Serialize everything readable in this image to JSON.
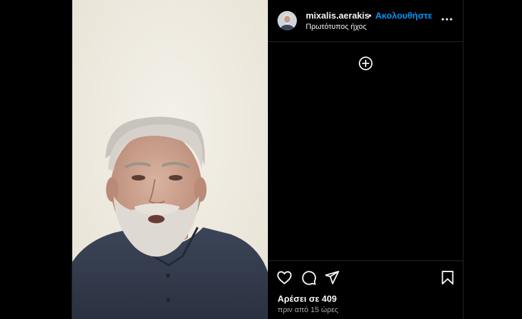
{
  "post": {
    "username": "mixalis.aerakis",
    "separator": "•",
    "follow_label": "Ακολουθήστε",
    "audio_label": "Πρωτότυπος ήχος",
    "likes_text": "Αρέσει σε 409",
    "timestamp": "πριν από 15 ώρες"
  },
  "icons": {
    "more": "more-options-icon",
    "add_comment": "add-circle-icon",
    "like": "heart-icon",
    "comment": "comment-icon",
    "share": "send-icon",
    "save": "bookmark-icon"
  },
  "colors": {
    "background": "#000000",
    "accent": "#0095f6",
    "text_primary": "#f5f5f5",
    "text_secondary": "#a8a8a8",
    "divider": "#262626"
  }
}
